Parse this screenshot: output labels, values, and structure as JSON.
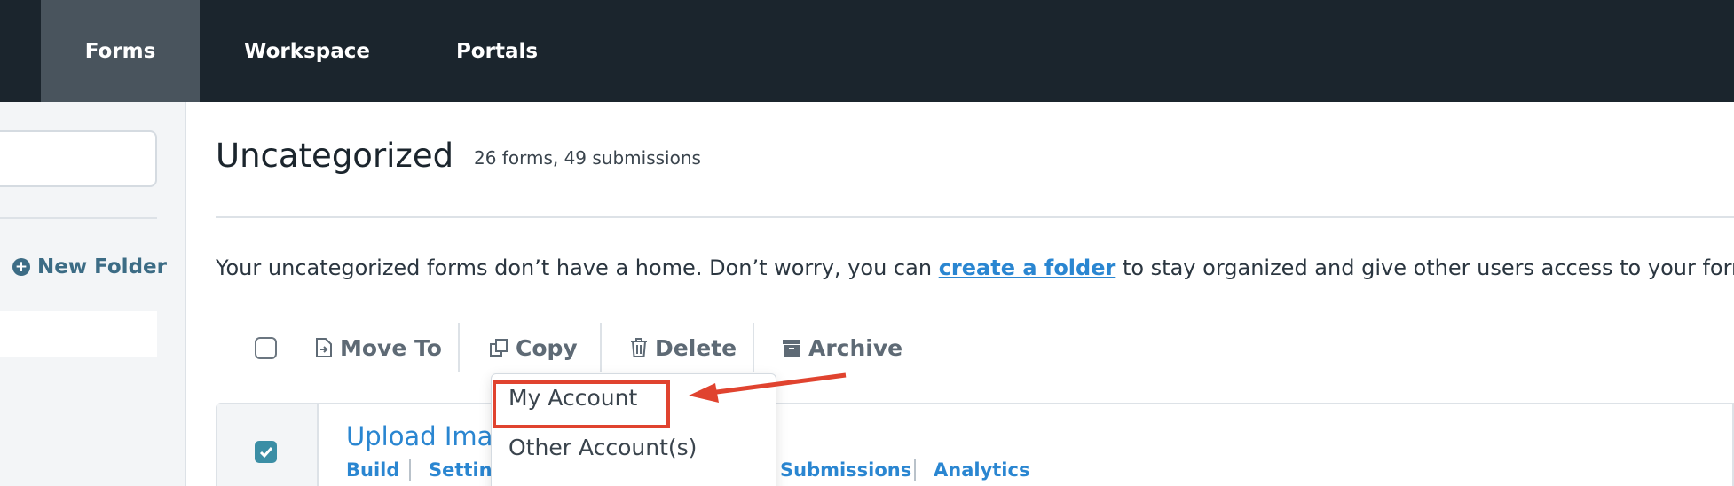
{
  "nav": {
    "tabs": [
      {
        "label": "Forms",
        "active": true
      },
      {
        "label": "Workspace",
        "active": false
      },
      {
        "label": "Portals",
        "active": false
      }
    ]
  },
  "sidebar": {
    "new_folder_label": "New Folder"
  },
  "main": {
    "title": "Uncategorized",
    "counts": "26 forms, 49 submissions",
    "info_before": "Your uncategorized forms don’t have a home. Don’t worry, you can ",
    "info_link": "create a folder",
    "info_after": " to stay organized and give other users access to your forms."
  },
  "toolbar": {
    "move_to": "Move To",
    "copy": "Copy",
    "delete": "Delete",
    "archive": "Archive"
  },
  "copy_menu": {
    "items": [
      "My Account",
      "Other Account(s)"
    ]
  },
  "form_row": {
    "title": "Upload Imag",
    "checked": true,
    "links": [
      "Build",
      "Setting",
      "Submissions",
      "Analytics"
    ]
  },
  "colors": {
    "nav_bg": "#1b252d",
    "nav_active": "#49545d",
    "link": "#2a86d1",
    "accent_teal": "#3b8ea5",
    "annotation_red": "#e0432f"
  },
  "icons": [
    "plus-circle-icon",
    "move-to-icon",
    "copy-icon",
    "trash-icon",
    "archive-icon",
    "checkmark-icon",
    "annotation-arrow-icon"
  ]
}
